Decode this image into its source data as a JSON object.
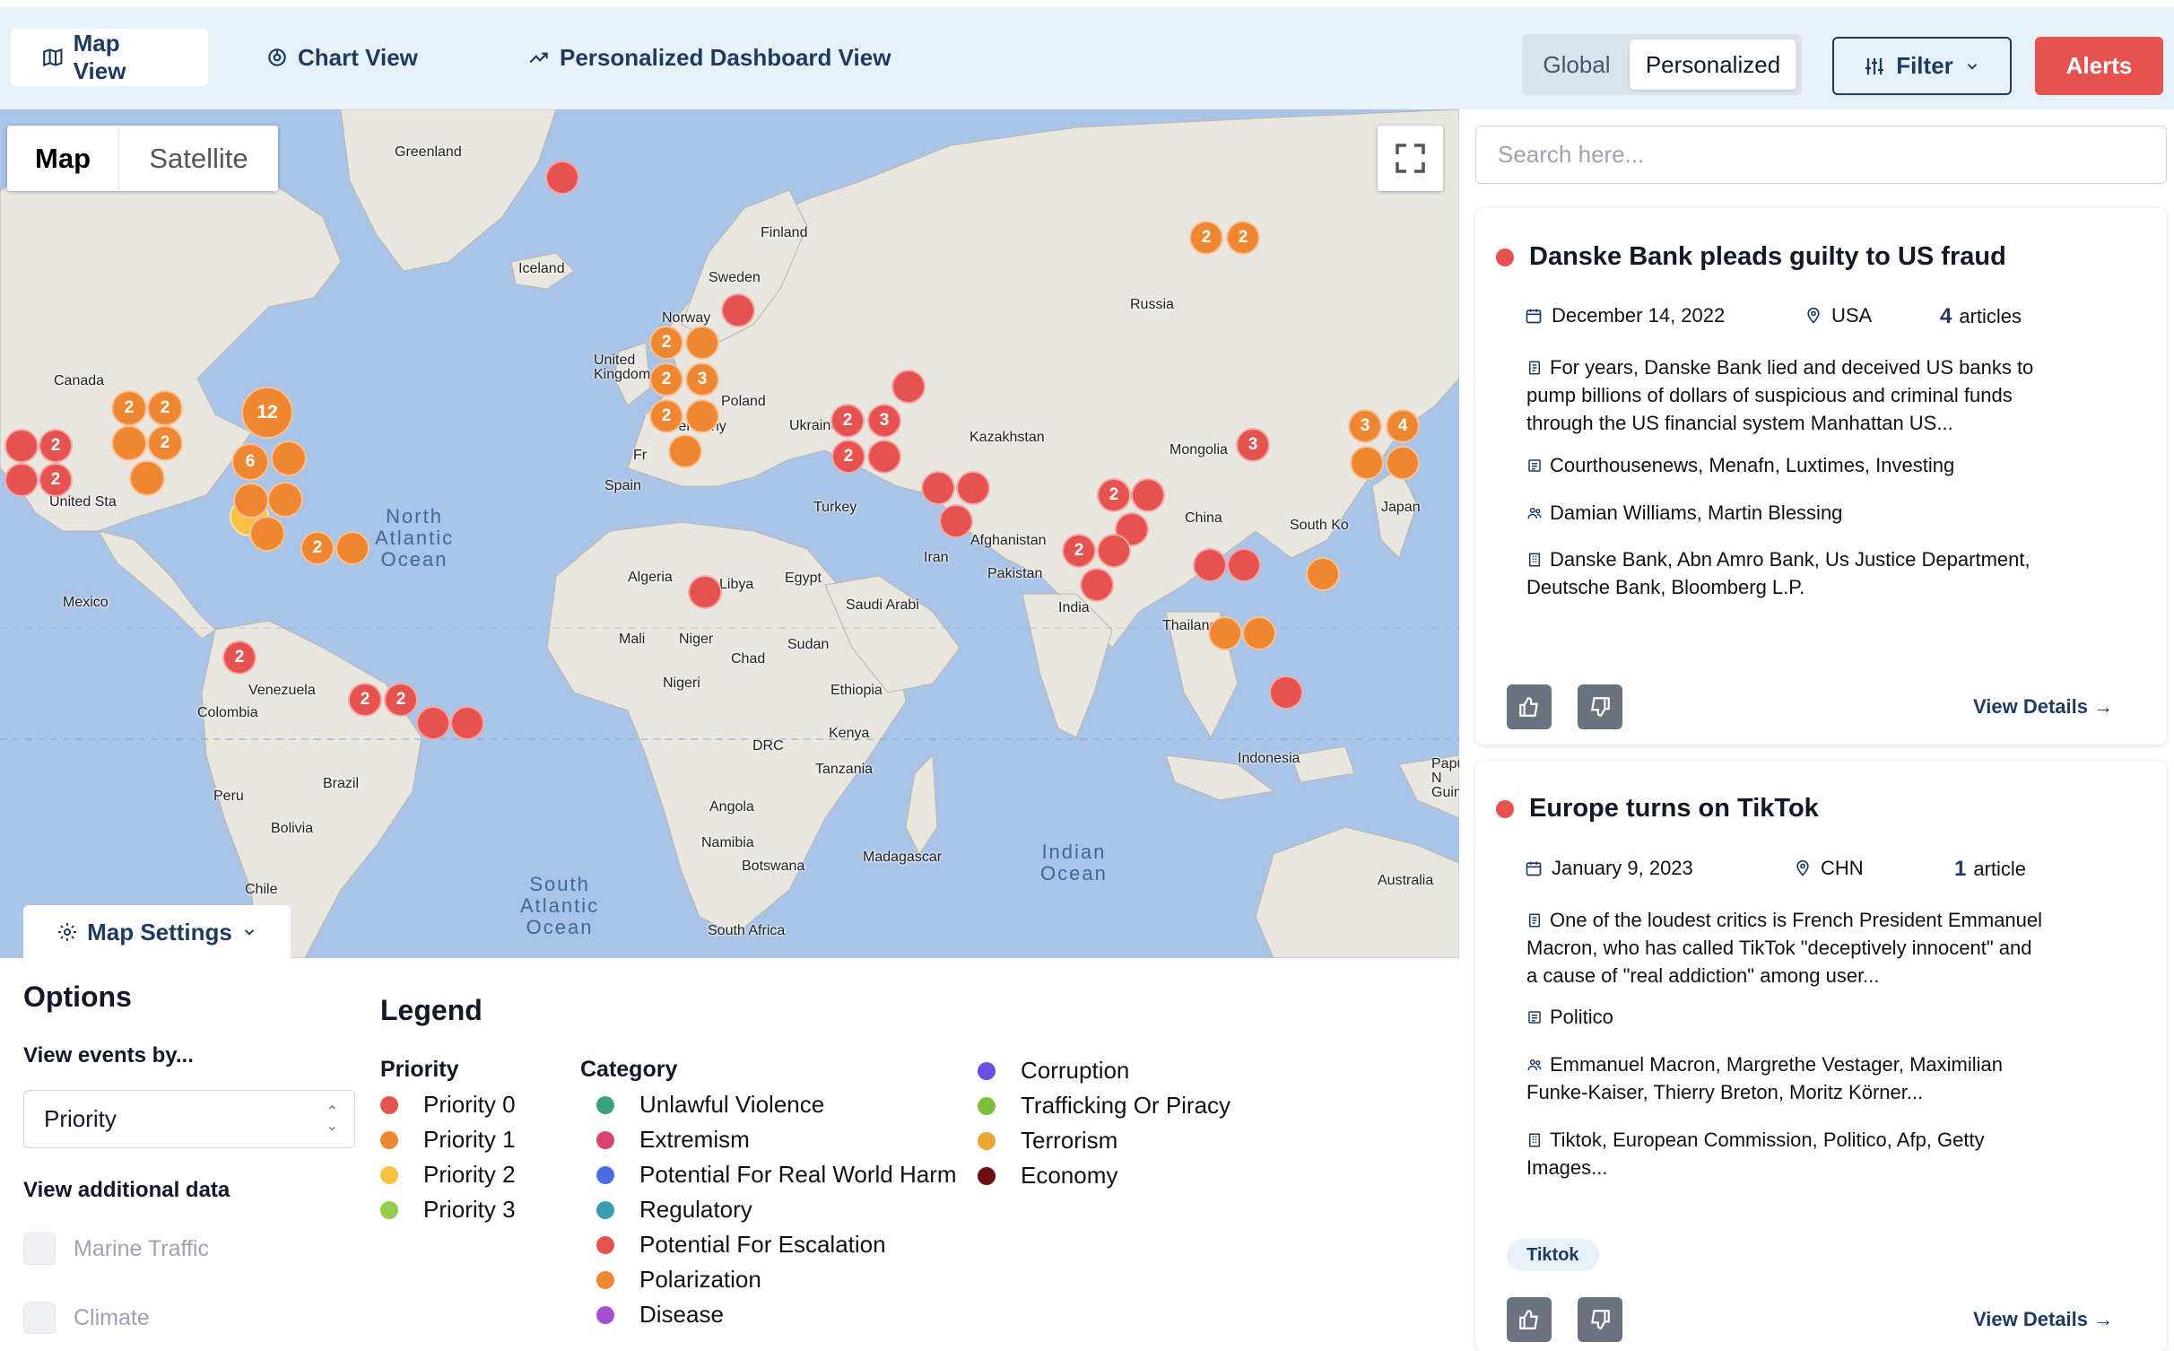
{
  "nav": {
    "tabs": [
      {
        "label": "Map View",
        "icon": "map-icon",
        "active": true
      },
      {
        "label": "Chart View",
        "icon": "chart-icon",
        "active": false
      },
      {
        "label": "Personalized Dashboard View",
        "icon": "trend-icon",
        "active": false
      }
    ],
    "scope": {
      "global": "Global",
      "personalized": "Personalized",
      "selected": "Personalized"
    },
    "filter_label": "Filter",
    "alerts_label": "Alerts"
  },
  "map": {
    "type_map": "Map",
    "type_satellite": "Satellite",
    "settings_label": "Map Settings",
    "places": [
      {
        "name": "Greenland"
      },
      {
        "name": "Iceland"
      },
      {
        "name": "Finland"
      },
      {
        "name": "Sweden"
      },
      {
        "name": "Norway"
      },
      {
        "name": "Russia"
      },
      {
        "name": "Canada"
      },
      {
        "name": "United\nKingdom"
      },
      {
        "name": "Poland"
      },
      {
        "name": "Germany"
      },
      {
        "name": "Ukraine"
      },
      {
        "name": "Kazakhstan"
      },
      {
        "name": "Mongolia"
      },
      {
        "name": "Fr"
      },
      {
        "name": "Spain"
      },
      {
        "name": "United Sta"
      },
      {
        "name": "Turkey"
      },
      {
        "name": "Japan"
      },
      {
        "name": "China"
      },
      {
        "name": "South Ko"
      },
      {
        "name": "Afghanistan"
      },
      {
        "name": "Iran"
      },
      {
        "name": "Pakistan"
      },
      {
        "name": "Mexico"
      },
      {
        "name": "Algeria"
      },
      {
        "name": "Libya"
      },
      {
        "name": "Egypt"
      },
      {
        "name": "Saudi Arabi"
      },
      {
        "name": "India"
      },
      {
        "name": "Thailand"
      },
      {
        "name": "Mali"
      },
      {
        "name": "Niger"
      },
      {
        "name": "Chad"
      },
      {
        "name": "Sudan"
      },
      {
        "name": "Venezuela"
      },
      {
        "name": "Nigeri"
      },
      {
        "name": "Ethiopia"
      },
      {
        "name": "Colombia"
      },
      {
        "name": "Kenya"
      },
      {
        "name": "DRC"
      },
      {
        "name": "Tanzania"
      },
      {
        "name": "Indonesia"
      },
      {
        "name": "Papua N\nGuinea"
      },
      {
        "name": "Peru"
      },
      {
        "name": "Brazil"
      },
      {
        "name": "Angola"
      },
      {
        "name": "Bolivia"
      },
      {
        "name": "Namibia"
      },
      {
        "name": "Madagascar"
      },
      {
        "name": "Botswana"
      },
      {
        "name": "Australia"
      },
      {
        "name": "Chile"
      },
      {
        "name": "South Africa"
      }
    ],
    "oceans": [
      {
        "name": "North\nAtlantic\nOcean"
      },
      {
        "name": "South\nAtlantic\nOcean"
      },
      {
        "name": "Indian\nOcean"
      }
    ],
    "markers": [
      {
        "count": "",
        "priority": "0"
      },
      {
        "count": "",
        "priority": "0"
      },
      {
        "count": "2",
        "priority": "0"
      },
      {
        "count": "",
        "priority": "0"
      },
      {
        "count": "2",
        "priority": "0"
      },
      {
        "count": "2",
        "priority": "1"
      },
      {
        "count": "2",
        "priority": "1"
      },
      {
        "count": "",
        "priority": "1"
      },
      {
        "count": "2",
        "priority": "1"
      },
      {
        "count": "",
        "priority": "1"
      },
      {
        "count": "12",
        "priority": "1"
      },
      {
        "count": "6",
        "priority": "1"
      },
      {
        "count": "",
        "priority": "1"
      },
      {
        "count": "",
        "priority": "2"
      },
      {
        "count": "",
        "priority": "1"
      },
      {
        "count": "",
        "priority": "1"
      },
      {
        "count": "",
        "priority": "1"
      },
      {
        "count": "2",
        "priority": "1"
      },
      {
        "count": "",
        "priority": "1"
      },
      {
        "count": "",
        "priority": "0"
      },
      {
        "count": "",
        "priority": "0"
      },
      {
        "count": "2",
        "priority": "1"
      },
      {
        "count": "",
        "priority": "1"
      },
      {
        "count": "2",
        "priority": "1"
      },
      {
        "count": "3",
        "priority": "1"
      },
      {
        "count": "2",
        "priority": "1"
      },
      {
        "count": "",
        "priority": "1"
      },
      {
        "count": "",
        "priority": "1"
      },
      {
        "count": "",
        "priority": "0"
      },
      {
        "count": "2",
        "priority": "0"
      },
      {
        "count": "3",
        "priority": "0"
      },
      {
        "count": "2",
        "priority": "0"
      },
      {
        "count": "",
        "priority": "0"
      },
      {
        "count": "",
        "priority": "0"
      },
      {
        "count": "",
        "priority": "0"
      },
      {
        "count": "",
        "priority": "0"
      },
      {
        "count": "2",
        "priority": "1"
      },
      {
        "count": "2",
        "priority": "1"
      },
      {
        "count": "2",
        "priority": "0"
      },
      {
        "count": "",
        "priority": "0"
      },
      {
        "count": "",
        "priority": "0"
      },
      {
        "count": "2",
        "priority": "0"
      },
      {
        "count": "",
        "priority": "0"
      },
      {
        "count": "",
        "priority": "0"
      },
      {
        "count": "3",
        "priority": "0"
      },
      {
        "count": "",
        "priority": "0"
      },
      {
        "count": "",
        "priority": "0"
      },
      {
        "count": "3",
        "priority": "1"
      },
      {
        "count": "4",
        "priority": "1"
      },
      {
        "count": "",
        "priority": "1"
      },
      {
        "count": "",
        "priority": "1"
      },
      {
        "count": "",
        "priority": "1"
      },
      {
        "count": "",
        "priority": "1"
      },
      {
        "count": "",
        "priority": "1"
      },
      {
        "count": "",
        "priority": "0"
      },
      {
        "count": "",
        "priority": "0"
      },
      {
        "count": "2",
        "priority": "0"
      },
      {
        "count": "2",
        "priority": "0"
      },
      {
        "count": "2",
        "priority": "0"
      },
      {
        "count": "",
        "priority": "0"
      },
      {
        "count": "",
        "priority": "0"
      }
    ]
  },
  "options": {
    "title": "Options",
    "view_by_label": "View events by...",
    "view_by_value": "Priority",
    "additional_label": "View additional data",
    "marine": "Marine Traffic",
    "climate": "Climate"
  },
  "legend": {
    "title": "Legend",
    "priority_heading": "Priority",
    "category_heading": "Category",
    "priorities": [
      {
        "label": "Priority 0",
        "color": "#e5524f"
      },
      {
        "label": "Priority 1",
        "color": "#ef8732"
      },
      {
        "label": "Priority 2",
        "color": "#f5c242"
      },
      {
        "label": "Priority 3",
        "color": "#95cc4a"
      }
    ],
    "categories": [
      {
        "label": "Unlawful Violence",
        "color": "#3aa17e"
      },
      {
        "label": "Extremism",
        "color": "#d9446e"
      },
      {
        "label": "Potential For Real World Harm",
        "color": "#4a6ee0"
      },
      {
        "label": "Regulatory",
        "color": "#3a9db0"
      },
      {
        "label": "Potential For Escalation",
        "color": "#e5524f"
      },
      {
        "label": "Polarization",
        "color": "#ef8732"
      },
      {
        "label": "Disease",
        "color": "#a24fd6"
      },
      {
        "label": "Corruption",
        "color": "#6a4fe0"
      },
      {
        "label": "Trafficking Or Piracy",
        "color": "#7cbf3a"
      },
      {
        "label": "Terrorism",
        "color": "#e8a934"
      },
      {
        "label": "Economy",
        "color": "#6b1010"
      }
    ]
  },
  "panel": {
    "search_placeholder": "Search here...",
    "cards": [
      {
        "title": "Danske Bank pleads guilty to US fraud",
        "date": "December 14, 2022",
        "location": "USA",
        "article_count": "4",
        "article_word": "articles",
        "summary": "For years, Danske Bank lied and deceived US banks to pump billions of dollars of suspicious and criminal funds through the US financial system Manhattan US...",
        "sources": "Courthousenews, Menafn, Luxtimes, Investing",
        "people": "Damian Williams, Martin Blessing",
        "entities": "Danske Bank, Abn Amro Bank, Us Justice Department, Deutsche Bank, Bloomberg L.P.",
        "view_label": "View Details →"
      },
      {
        "title": "Europe turns on TikTok",
        "date": "January 9, 2023",
        "location": "CHN",
        "article_count": "1",
        "article_word": "article",
        "summary": "One of the loudest critics is French President Emmanuel Macron, who has called TikTok \"deceptively innocent\" and a cause of \"real addiction\" among user...",
        "sources": "Politico",
        "people": "Emmanuel Macron, Margrethe Vestager, Maximilian Funke-Kaiser, Thierry Breton, Moritz Körner...",
        "entities": "Tiktok, European Commission, Politico, Afp, Getty Images...",
        "tag": "Tiktok",
        "view_label": "View Details →"
      }
    ]
  }
}
